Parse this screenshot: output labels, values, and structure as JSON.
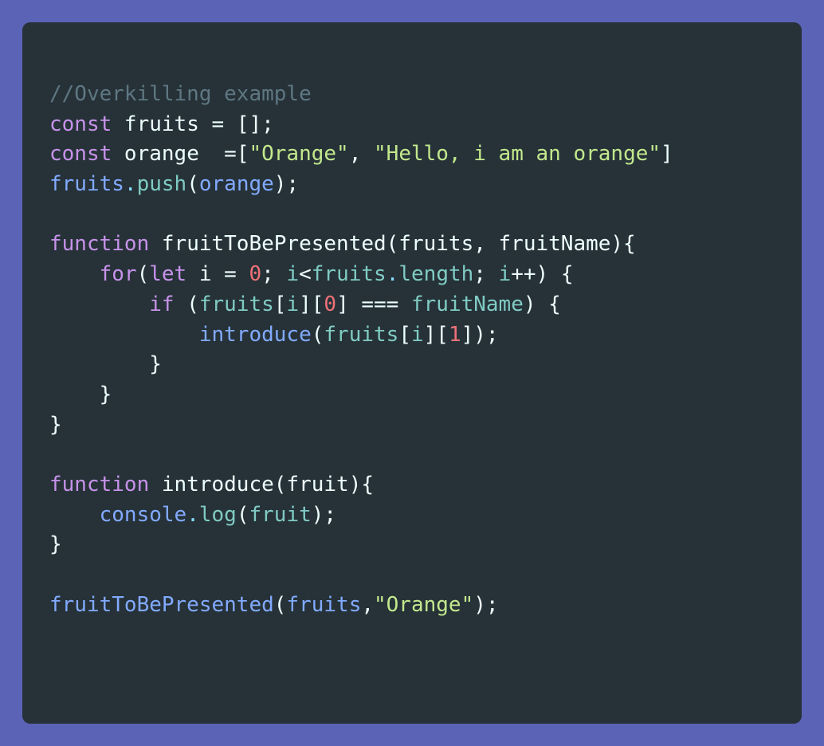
{
  "colors": {
    "frame_background": "#5b63b7",
    "editor_background": "#263238",
    "comment": "#5f7782",
    "keyword": "#c792ea",
    "text": "#eeffff",
    "function": "#82aaff",
    "property": "#80cbc4",
    "string": "#c3e88d",
    "number": "#f07178",
    "punctuation": "#89ddff"
  },
  "code": {
    "lines": [
      [
        {
          "t": "//Overkilling example",
          "c": "comment"
        }
      ],
      [
        {
          "t": "const",
          "c": "keyword"
        },
        {
          "t": " fruits = [];",
          "c": "text"
        }
      ],
      [
        {
          "t": "const",
          "c": "keyword"
        },
        {
          "t": " orange  =[",
          "c": "text"
        },
        {
          "t": "\"Orange\"",
          "c": "string"
        },
        {
          "t": ", ",
          "c": "text"
        },
        {
          "t": "\"Hello, i am an orange\"",
          "c": "string"
        },
        {
          "t": "]",
          "c": "text"
        }
      ],
      [
        {
          "t": "fruits",
          "c": "function"
        },
        {
          "t": ".",
          "c": "punctuation"
        },
        {
          "t": "push",
          "c": "property"
        },
        {
          "t": "(",
          "c": "text"
        },
        {
          "t": "orange",
          "c": "function"
        },
        {
          "t": ");",
          "c": "text"
        }
      ],
      [],
      [
        {
          "t": "function",
          "c": "keyword"
        },
        {
          "t": " fruitToBePresented(fruits, fruitName){",
          "c": "text"
        }
      ],
      [
        {
          "t": "    ",
          "c": "text"
        },
        {
          "t": "for",
          "c": "keyword"
        },
        {
          "t": "(",
          "c": "text"
        },
        {
          "t": "let",
          "c": "keyword"
        },
        {
          "t": " i = ",
          "c": "text"
        },
        {
          "t": "0",
          "c": "number"
        },
        {
          "t": "; ",
          "c": "text"
        },
        {
          "t": "i",
          "c": "property"
        },
        {
          "t": "<",
          "c": "text"
        },
        {
          "t": "fruits",
          "c": "property"
        },
        {
          "t": ".",
          "c": "punctuation"
        },
        {
          "t": "length",
          "c": "property"
        },
        {
          "t": "; ",
          "c": "text"
        },
        {
          "t": "i",
          "c": "property"
        },
        {
          "t": "++) {",
          "c": "text"
        }
      ],
      [
        {
          "t": "        ",
          "c": "text"
        },
        {
          "t": "if",
          "c": "keyword"
        },
        {
          "t": " (",
          "c": "text"
        },
        {
          "t": "fruits",
          "c": "property"
        },
        {
          "t": "[",
          "c": "text"
        },
        {
          "t": "i",
          "c": "property"
        },
        {
          "t": "][",
          "c": "text"
        },
        {
          "t": "0",
          "c": "number"
        },
        {
          "t": "] === ",
          "c": "text"
        },
        {
          "t": "fruitName",
          "c": "property"
        },
        {
          "t": ") {",
          "c": "text"
        }
      ],
      [
        {
          "t": "            ",
          "c": "text"
        },
        {
          "t": "introduce",
          "c": "function"
        },
        {
          "t": "(",
          "c": "text"
        },
        {
          "t": "fruits",
          "c": "property"
        },
        {
          "t": "[",
          "c": "text"
        },
        {
          "t": "i",
          "c": "property"
        },
        {
          "t": "][",
          "c": "text"
        },
        {
          "t": "1",
          "c": "number"
        },
        {
          "t": "]);",
          "c": "text"
        }
      ],
      [
        {
          "t": "        }",
          "c": "text"
        }
      ],
      [
        {
          "t": "    }",
          "c": "text"
        }
      ],
      [
        {
          "t": "}",
          "c": "text"
        }
      ],
      [],
      [
        {
          "t": "function",
          "c": "keyword"
        },
        {
          "t": " introduce(fruit){",
          "c": "text"
        }
      ],
      [
        {
          "t": "    ",
          "c": "text"
        },
        {
          "t": "console",
          "c": "function"
        },
        {
          "t": ".",
          "c": "punctuation"
        },
        {
          "t": "log",
          "c": "property"
        },
        {
          "t": "(",
          "c": "text"
        },
        {
          "t": "fruit",
          "c": "property"
        },
        {
          "t": ");",
          "c": "text"
        }
      ],
      [
        {
          "t": "}",
          "c": "text"
        }
      ],
      [],
      [
        {
          "t": "fruitToBePresented",
          "c": "function"
        },
        {
          "t": "(",
          "c": "text"
        },
        {
          "t": "fruits",
          "c": "function"
        },
        {
          "t": ",",
          "c": "text"
        },
        {
          "t": "\"Orange\"",
          "c": "string"
        },
        {
          "t": ");",
          "c": "text"
        }
      ]
    ]
  }
}
